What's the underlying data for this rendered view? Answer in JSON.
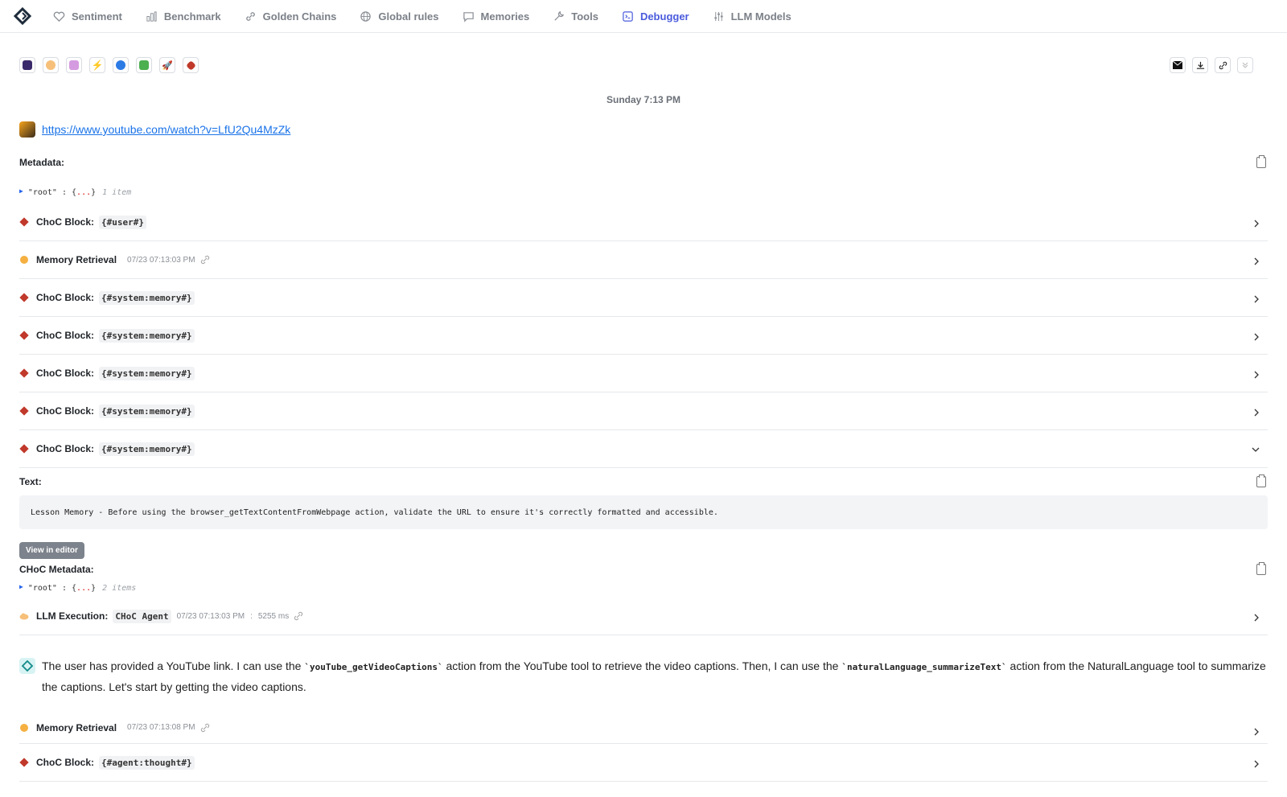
{
  "nav": {
    "items": [
      {
        "label": "Sentiment",
        "icon": "heart-icon"
      },
      {
        "label": "Benchmark",
        "icon": "bar-chart-icon"
      },
      {
        "label": "Golden Chains",
        "icon": "chain-link-icon"
      },
      {
        "label": "Global rules",
        "icon": "globe-icon"
      },
      {
        "label": "Memories",
        "icon": "speech-bubble-icon"
      },
      {
        "label": "Tools",
        "icon": "wrench-icon"
      },
      {
        "label": "Debugger",
        "icon": "terminal-icon"
      },
      {
        "label": "LLM Models",
        "icon": "sliders-icon"
      }
    ],
    "active": "Debugger"
  },
  "timestamp": "Sunday 7:13 PM",
  "url": "https://www.youtube.com/watch?v=LfU2Qu4MzZk",
  "metadata_label": "Metadata:",
  "json1": {
    "key": "\"root\"",
    "colon": " : ",
    "open": "{",
    "dots": "...",
    "close": "}",
    "count": "1 item"
  },
  "events": [
    {
      "label": "ChoC Block:",
      "code": "{#user#}"
    },
    {
      "label": "Memory Retrieval",
      "meta": "07/23 07:13:03 PM"
    },
    {
      "label": "ChoC Block:",
      "code": "{#system:memory#}"
    },
    {
      "label": "ChoC Block:",
      "code": "{#system:memory#}"
    },
    {
      "label": "ChoC Block:",
      "code": "{#system:memory#}"
    },
    {
      "label": "ChoC Block:",
      "code": "{#system:memory#}"
    },
    {
      "label": "ChoC Block:",
      "code": "{#system:memory#}"
    }
  ],
  "text_label": "Text:",
  "lesson_text": "Lesson Memory - Before using the browser_getTextContentFromWebpage action, validate the URL to ensure it's correctly formatted and accessible.",
  "view_editor": "View in editor",
  "choc_metadata_label": "CHoC Metadata:",
  "json2": {
    "key": "\"root\"",
    "colon": " : ",
    "open": "{",
    "dots": "...",
    "close": "}",
    "count": "2 items"
  },
  "llm_exec": {
    "label": "LLM Execution:",
    "code": "CHoC Agent",
    "meta": "07/23 07:13:03 PM",
    "sep": ":",
    "duration": "5255 ms"
  },
  "agent_message": {
    "p1": "The user has provided a YouTube link. I can use the ",
    "c1": "`youTube_getVideoCaptions`",
    "p2": " action from the YouTube tool to retrieve the video captions. Then, I can use the ",
    "c2": "`naturalLanguage_summarizeText`",
    "p3": " action from the NaturalLanguage tool to summarize the captions. Let's start by getting the video captions."
  },
  "events2": [
    {
      "label": "Memory Retrieval",
      "meta": "07/23 07:13:08 PM"
    },
    {
      "label": "ChoC Block:",
      "code": "{#agent:thought#}"
    }
  ],
  "colors": {
    "accent": "#4a5bdc",
    "link": "#1a73e8",
    "choc": "#c0392b"
  }
}
